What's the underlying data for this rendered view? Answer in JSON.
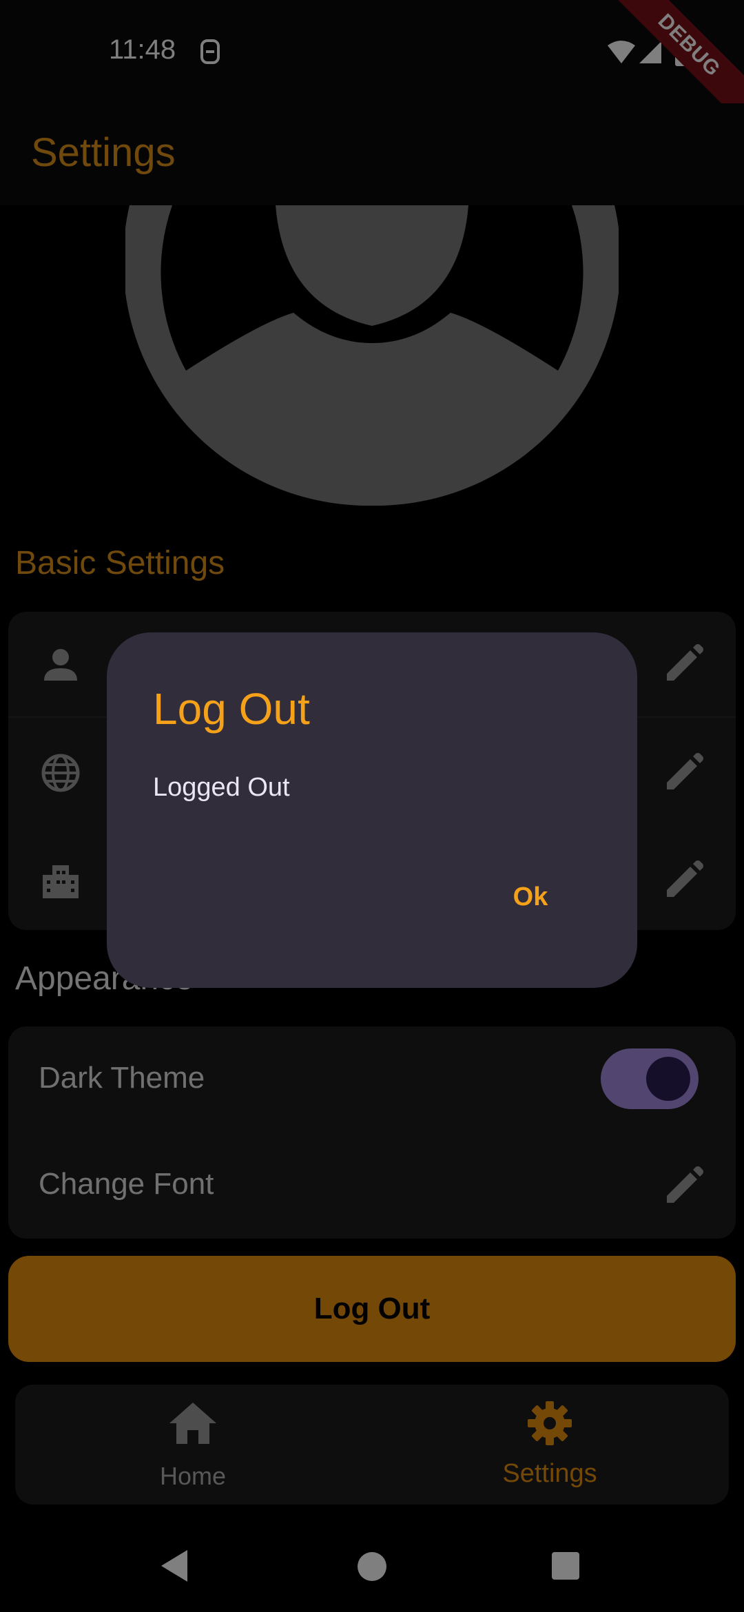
{
  "status_bar": {
    "time": "11:48",
    "debug_badge": "DEBUG"
  },
  "app_bar": {
    "title": "Settings"
  },
  "sections": {
    "basic": "Basic Settings",
    "appearance": "Appearance"
  },
  "basic_rows": [
    {
      "icon": "person-icon"
    },
    {
      "icon": "globe-icon"
    },
    {
      "icon": "building-icon"
    }
  ],
  "appearance_rows": {
    "dark_theme": "Dark Theme",
    "dark_theme_on": true,
    "change_font": "Change Font"
  },
  "logout_button": "Log Out",
  "bottom_nav": {
    "items": [
      {
        "label": "Home",
        "icon": "home-icon",
        "active": false
      },
      {
        "label": "Settings",
        "icon": "gear-icon",
        "active": true
      }
    ]
  },
  "dialog": {
    "title": "Log Out",
    "message": "Logged Out",
    "ok_label": "Ok"
  },
  "colors": {
    "accent": "#f5a21a",
    "dialog_bg": "#312d3b",
    "card_bg": "#1c1c1e"
  }
}
